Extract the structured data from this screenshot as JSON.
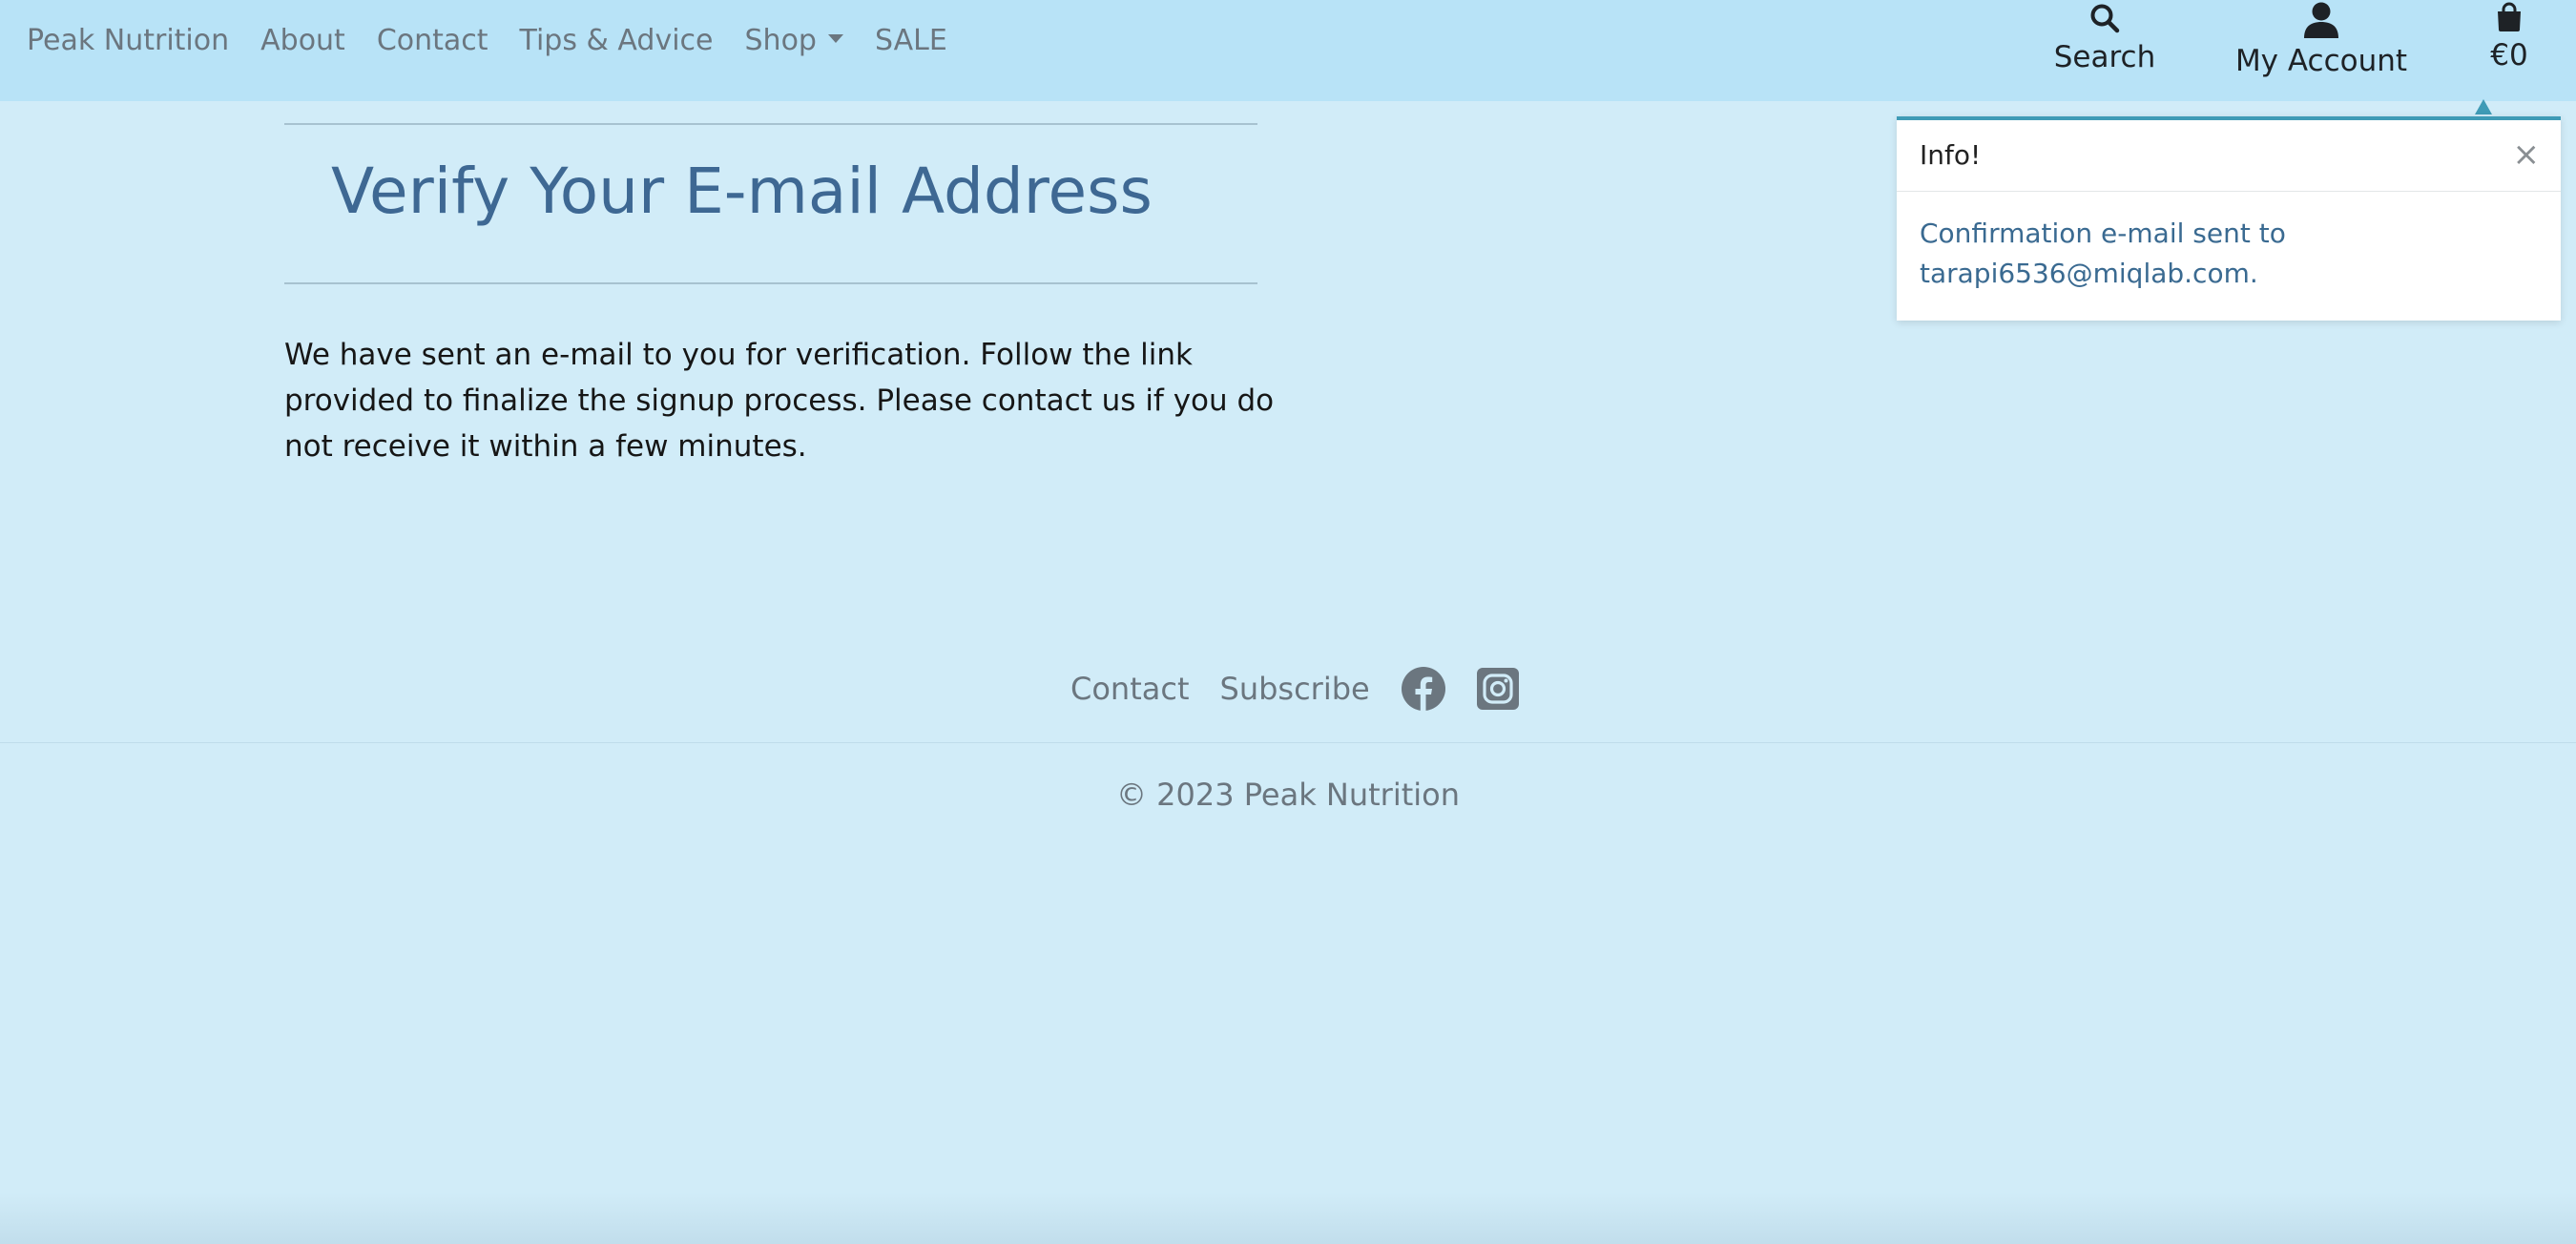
{
  "nav": {
    "brand": "Peak Nutrition",
    "links": [
      "About",
      "Contact",
      "Tips & Advice",
      "Shop",
      "SALE"
    ],
    "search_label": "Search",
    "account_label": "My Account",
    "cart_label": "€0",
    "icons": {
      "search": "search-icon",
      "account": "user-icon",
      "cart": "shopping-bag-icon",
      "shop_dropdown": "caret-down-icon"
    }
  },
  "main": {
    "title": "Verify Your E-mail Address",
    "body": "We have sent an e-mail to you for verification. Follow the link provided to finalize the signup process. Please contact us if you do not receive it within a few minutes."
  },
  "toast": {
    "title": "Info!",
    "close_label": "×",
    "message": "Confirmation e-mail sent to tarapi6536@miqlab.com.",
    "accent_color": "#3f9bb6"
  },
  "footer": {
    "links": [
      "Contact",
      "Subscribe"
    ],
    "social_icons": [
      "facebook-icon",
      "instagram-icon"
    ],
    "copyright": "© 2023 Peak Nutrition"
  },
  "colors": {
    "navbar_bg": "#b8e3f7",
    "page_bg": "#d1ecf8",
    "title_color": "#3e6893",
    "muted_text": "#6b767f"
  }
}
